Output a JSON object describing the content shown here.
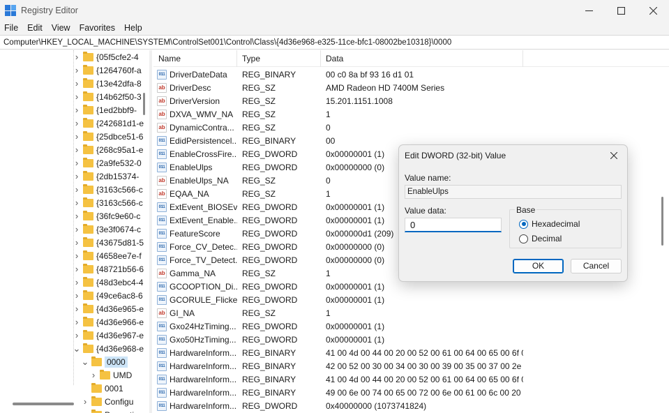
{
  "window": {
    "title": "Registry Editor"
  },
  "menu": [
    "File",
    "Edit",
    "View",
    "Favorites",
    "Help"
  ],
  "address": "Computer\\HKEY_LOCAL_MACHINE\\SYSTEM\\ControlSet001\\Control\\Class\\{4d36e968-e325-11ce-bfc1-08002be10318}\\0000",
  "tree": [
    {
      "label": "{05f5cfe2-4",
      "indent": 0,
      "chevron": ">"
    },
    {
      "label": "{1264760f-a",
      "indent": 0,
      "chevron": ">"
    },
    {
      "label": "{13e42dfa-8",
      "indent": 0,
      "chevron": ">"
    },
    {
      "label": "{14b62f50-3",
      "indent": 0,
      "chevron": ">"
    },
    {
      "label": "{1ed2bbf9-",
      "indent": 0,
      "chevron": ">"
    },
    {
      "label": "{242681d1-e",
      "indent": 0,
      "chevron": ">"
    },
    {
      "label": "{25dbce51-6",
      "indent": 0,
      "chevron": ">"
    },
    {
      "label": "{268c95a1-e",
      "indent": 0,
      "chevron": ">"
    },
    {
      "label": "{2a9fe532-0",
      "indent": 0,
      "chevron": ">"
    },
    {
      "label": "{2db15374-",
      "indent": 0,
      "chevron": ">"
    },
    {
      "label": "{3163c566-c",
      "indent": 0,
      "chevron": ">"
    },
    {
      "label": "{3163c566-c",
      "indent": 0,
      "chevron": ">"
    },
    {
      "label": "{36fc9e60-c",
      "indent": 0,
      "chevron": ">"
    },
    {
      "label": "{3e3f0674-c",
      "indent": 0,
      "chevron": ">"
    },
    {
      "label": "{43675d81-5",
      "indent": 0,
      "chevron": ">"
    },
    {
      "label": "{4658ee7e-f",
      "indent": 0,
      "chevron": ">"
    },
    {
      "label": "{48721b56-6",
      "indent": 0,
      "chevron": ">"
    },
    {
      "label": "{48d3ebc4-4",
      "indent": 0,
      "chevron": ">"
    },
    {
      "label": "{49ce6ac8-6",
      "indent": 0,
      "chevron": ">"
    },
    {
      "label": "{4d36e965-e",
      "indent": 0,
      "chevron": ">"
    },
    {
      "label": "{4d36e966-e",
      "indent": 0,
      "chevron": ">"
    },
    {
      "label": "{4d36e967-e",
      "indent": 0,
      "chevron": ">"
    },
    {
      "label": "{4d36e968-e",
      "indent": 0,
      "chevron": "v"
    },
    {
      "label": "0000",
      "indent": 1,
      "chevron": "v",
      "selected": true
    },
    {
      "label": "UMD",
      "indent": 2,
      "chevron": ">"
    },
    {
      "label": "0001",
      "indent": 1,
      "chevron": ""
    },
    {
      "label": "Configu",
      "indent": 1,
      "chevron": ">"
    },
    {
      "label": "Propertie",
      "indent": 1,
      "chevron": ""
    }
  ],
  "columns": {
    "name": "Name",
    "type": "Type",
    "data": "Data"
  },
  "rows": [
    {
      "name": "DriverDateData",
      "type": "REG_BINARY",
      "data": "00 c0 8a bf 93 16 d1 01",
      "icon": "bin"
    },
    {
      "name": "DriverDesc",
      "type": "REG_SZ",
      "data": "AMD Radeon HD 7400M Series",
      "icon": "ab"
    },
    {
      "name": "DriverVersion",
      "type": "REG_SZ",
      "data": "15.201.1151.1008",
      "icon": "ab"
    },
    {
      "name": "DXVA_WMV_NA",
      "type": "REG_SZ",
      "data": "1",
      "icon": "ab"
    },
    {
      "name": "DynamicContra...",
      "type": "REG_SZ",
      "data": "0",
      "icon": "ab"
    },
    {
      "name": "EdidPersistencel...",
      "type": "REG_BINARY",
      "data": "00",
      "icon": "bin"
    },
    {
      "name": "EnableCrossFire...",
      "type": "REG_DWORD",
      "data": "0x00000001 (1)",
      "icon": "bin"
    },
    {
      "name": "EnableUlps",
      "type": "REG_DWORD",
      "data": "0x00000000 (0)",
      "icon": "bin"
    },
    {
      "name": "EnableUlps_NA",
      "type": "REG_SZ",
      "data": "0",
      "icon": "ab"
    },
    {
      "name": "EQAA_NA",
      "type": "REG_SZ",
      "data": "1",
      "icon": "ab"
    },
    {
      "name": "ExtEvent_BIOSEv...",
      "type": "REG_DWORD",
      "data": "0x00000001 (1)",
      "icon": "bin"
    },
    {
      "name": "ExtEvent_Enable...",
      "type": "REG_DWORD",
      "data": "0x00000001 (1)",
      "icon": "bin"
    },
    {
      "name": "FeatureScore",
      "type": "REG_DWORD",
      "data": "0x000000d1 (209)",
      "icon": "bin"
    },
    {
      "name": "Force_CV_Detec...",
      "type": "REG_DWORD",
      "data": "0x00000000 (0)",
      "icon": "bin"
    },
    {
      "name": "Force_TV_Detect...",
      "type": "REG_DWORD",
      "data": "0x00000000 (0)",
      "icon": "bin"
    },
    {
      "name": "Gamma_NA",
      "type": "REG_SZ",
      "data": "1",
      "icon": "ab"
    },
    {
      "name": "GCOOPTION_Di...",
      "type": "REG_DWORD",
      "data": "0x00000001 (1)",
      "icon": "bin"
    },
    {
      "name": "GCORULE_Flicke...",
      "type": "REG_DWORD",
      "data": "0x00000001 (1)",
      "icon": "bin"
    },
    {
      "name": "GI_NA",
      "type": "REG_SZ",
      "data": "1",
      "icon": "ab"
    },
    {
      "name": "Gxo24HzTiming...",
      "type": "REG_DWORD",
      "data": "0x00000001 (1)",
      "icon": "bin"
    },
    {
      "name": "Gxo50HzTiming...",
      "type": "REG_DWORD",
      "data": "0x00000001 (1)",
      "icon": "bin"
    },
    {
      "name": "HardwareInform...",
      "type": "REG_BINARY",
      "data": "41 00 4d 00 44 00 20 00 52 00 61 00 64 00 65 00 6f 00...",
      "icon": "bin"
    },
    {
      "name": "HardwareInform...",
      "type": "REG_BINARY",
      "data": "42 00 52 00 30 00 34 00 30 00 39 00 35 00 37 00 2e 00...",
      "icon": "bin"
    },
    {
      "name": "HardwareInform...",
      "type": "REG_BINARY",
      "data": "41 00 4d 00 44 00 20 00 52 00 61 00 64 00 65 00 6f 00...",
      "icon": "bin"
    },
    {
      "name": "HardwareInform...",
      "type": "REG_BINARY",
      "data": "49 00 6e 00 74 00 65 00 72 00 6e 00 61 00 6c 00 20 00...",
      "icon": "bin"
    },
    {
      "name": "HardwareInform...",
      "type": "REG_DWORD",
      "data": "0x40000000 (1073741824)",
      "icon": "bin"
    }
  ],
  "dialog": {
    "title": "Edit DWORD (32-bit) Value",
    "value_name_label": "Value name:",
    "value_name": "EnableUlps",
    "value_data_label": "Value data:",
    "value_data": "0",
    "base_label": "Base",
    "hex_label": "Hexadecimal",
    "dec_label": "Decimal",
    "selected_base": "hex",
    "ok": "OK",
    "cancel": "Cancel"
  },
  "colors": {
    "accent": "#0067c0",
    "folder": "#f5c242",
    "selection": "#cce4f7"
  }
}
